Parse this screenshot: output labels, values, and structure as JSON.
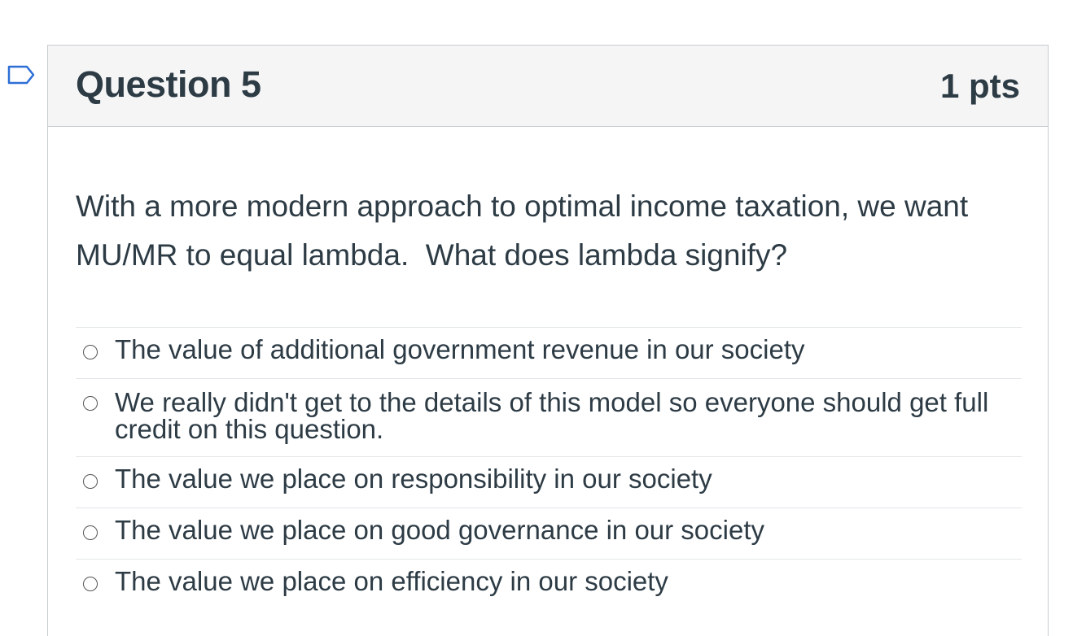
{
  "question": {
    "title": "Question 5",
    "points": "1 pts",
    "text": "With a more modern approach to optimal income taxation, we want MU/MR to equal lambda.  What does lambda signify?"
  },
  "flag": {
    "icon": "bookmark-flag-icon",
    "color": "#2d6fd6"
  },
  "answers": [
    {
      "label": "The value of additional government revenue in our society"
    },
    {
      "label": "We really didn't get to the details of this model so everyone should get full credit on this question."
    },
    {
      "label": "The value we place on responsibility in our society"
    },
    {
      "label": "The value we place on good governance in our society"
    },
    {
      "label": "The value we place on efficiency in our society"
    }
  ]
}
